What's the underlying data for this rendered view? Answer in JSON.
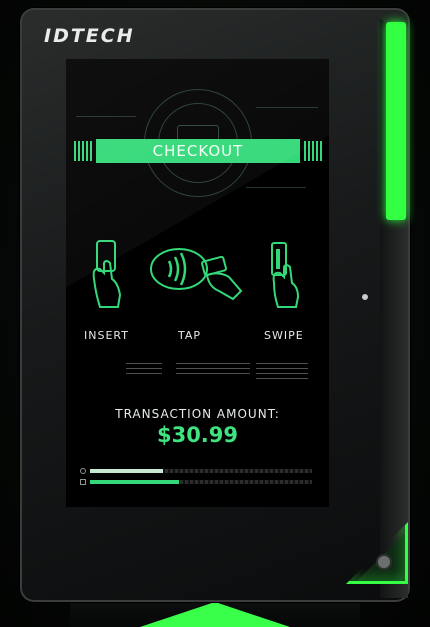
{
  "device": {
    "brand": "IDTECH"
  },
  "screen": {
    "header": "CHECKOUT",
    "payment_methods": [
      {
        "label": "INSERT",
        "icon": "card-insert-icon"
      },
      {
        "label": "TAP",
        "icon": "contactless-tap-icon"
      },
      {
        "label": "SWIPE",
        "icon": "card-swipe-icon"
      }
    ],
    "transaction": {
      "label": "TRANSACTION AMOUNT:",
      "amount": "$30.99"
    },
    "progress": [
      {
        "fraction": 0.33,
        "fill_color": "#c9e8d4"
      },
      {
        "fraction": 0.4,
        "fill_color": "#33d878"
      }
    ]
  },
  "colors": {
    "accent": "#33d878",
    "light": "#33ff43",
    "amount": "#3fe37f"
  }
}
